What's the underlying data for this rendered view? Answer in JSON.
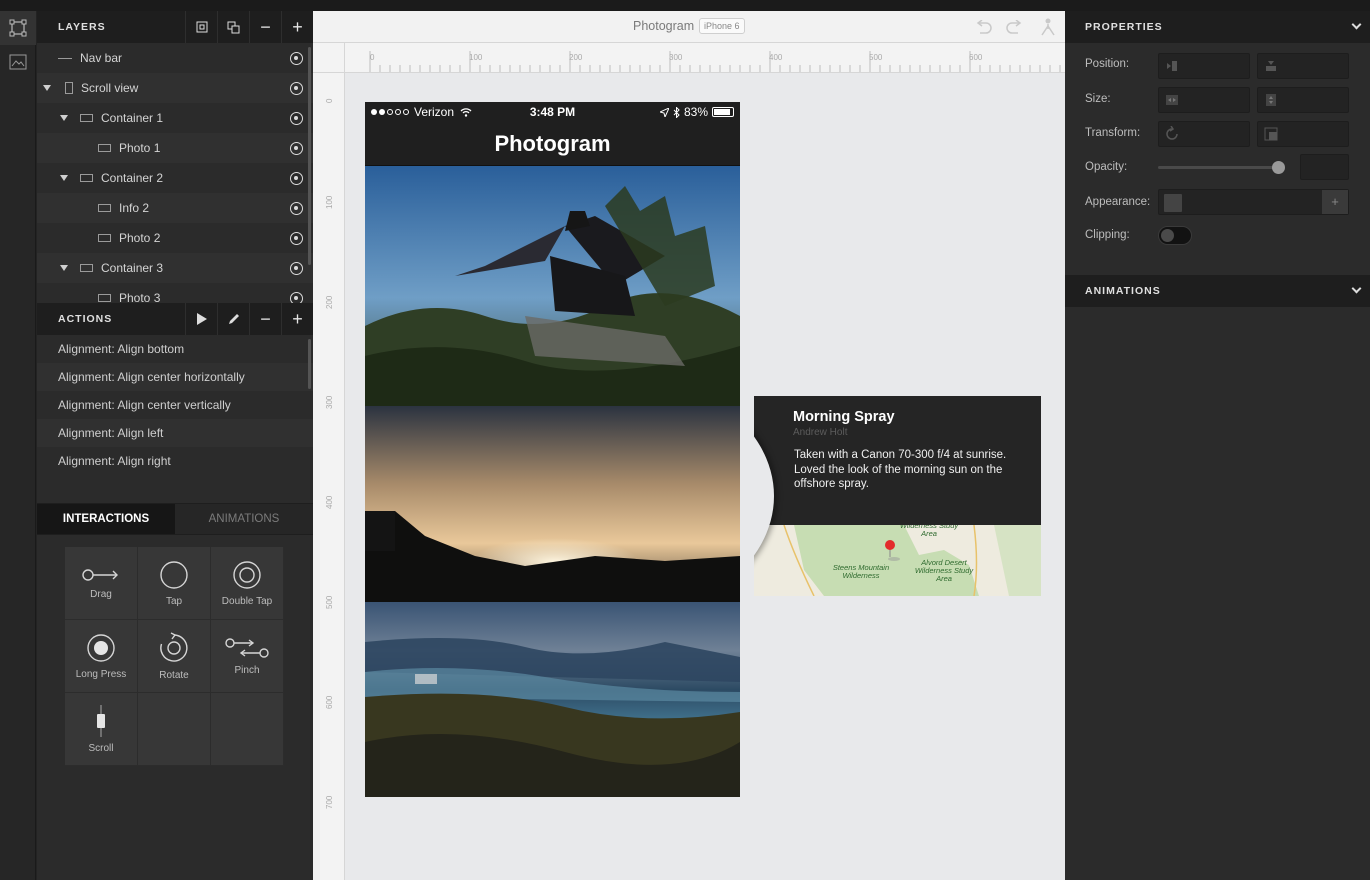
{
  "layers_panel": {
    "title": "LAYERS",
    "items": [
      {
        "label": "Nav bar"
      },
      {
        "label": "Scroll view"
      },
      {
        "label": "Container 1"
      },
      {
        "label": "Photo 1"
      },
      {
        "label": "Container 2"
      },
      {
        "label": "Info 2"
      },
      {
        "label": "Photo 2"
      },
      {
        "label": "Container 3"
      },
      {
        "label": "Photo 3"
      }
    ]
  },
  "actions_panel": {
    "title": "ACTIONS",
    "items": [
      "Alignment: Align bottom",
      "Alignment: Align center horizontally",
      "Alignment: Align center vertically",
      "Alignment: Align left",
      "Alignment: Align right"
    ]
  },
  "interaction_tabs": {
    "interactions": "INTERACTIONS",
    "animations": "ANIMATIONS"
  },
  "gestures": [
    "Drag",
    "Tap",
    "Double Tap",
    "Long Press",
    "Rotate",
    "Pinch",
    "Scroll"
  ],
  "canvas": {
    "doc_title": "Photogram",
    "device": "iPhone 6",
    "ruler_h": [
      "0",
      "100",
      "200",
      "300",
      "400",
      "500",
      "600"
    ],
    "ruler_v": [
      "0",
      "100",
      "200",
      "300",
      "400",
      "500",
      "600",
      "700"
    ]
  },
  "phone": {
    "carrier": "Verizon",
    "time": "3:48 PM",
    "battery": "83%",
    "title": "Photogram"
  },
  "info_card": {
    "title": "Morning Spray",
    "author": "Andrew Holt",
    "description": "Taken with a Canon 70-300 f/4 at sunrise. Loved the look of the morning sun on the offshore spray.",
    "map_labels": [
      "Wilderness Study Area",
      "Steens Mountain Wilderness",
      "Alvord Desert Wilderness Study Area"
    ]
  },
  "properties_panel": {
    "title": "PROPERTIES",
    "rows": {
      "position": "Position:",
      "size": "Size:",
      "transform": "Transform:",
      "opacity": "Opacity:",
      "appearance": "Appearance:",
      "clipping": "Clipping:"
    },
    "opacity_level": 1.0,
    "clipping_on": false,
    "add_symbol": "+"
  },
  "animations_panel": {
    "title": "ANIMATIONS"
  },
  "colors": {
    "panel": "#2b2b2b",
    "header": "#1e1e1e",
    "canvas": "#e8e9eb"
  }
}
